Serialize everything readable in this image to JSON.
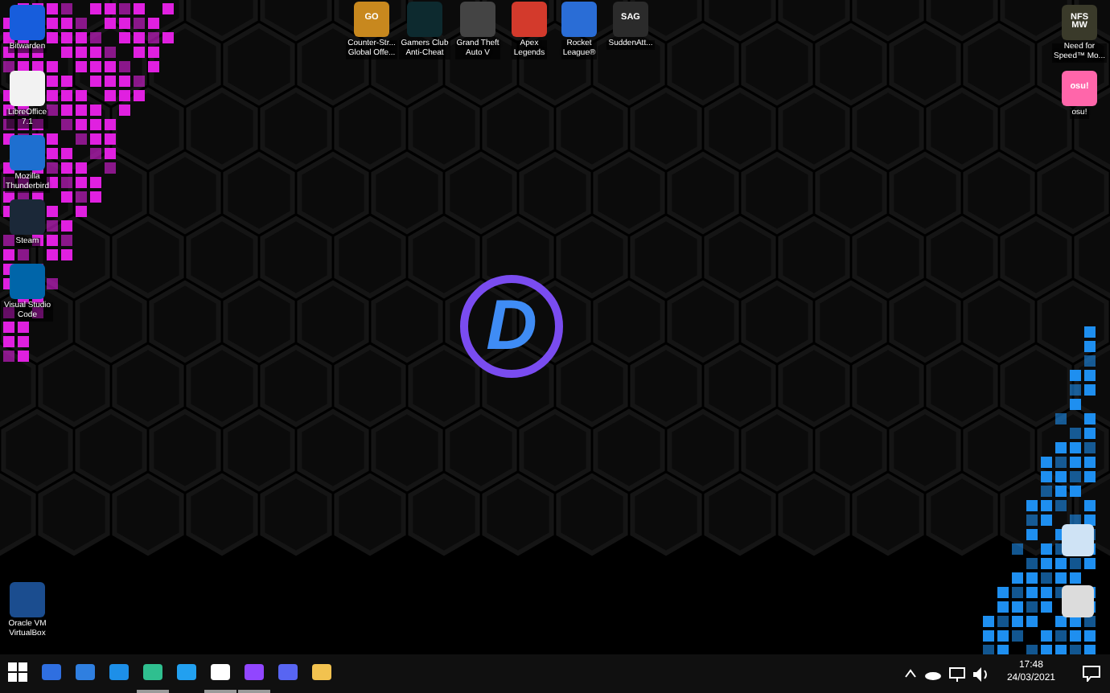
{
  "desktop_icons": [
    {
      "label": "Bitwarden"
    },
    {
      "label": "LibreOffice\n7.1"
    },
    {
      "label": "Mozilla\nThunderbird"
    },
    {
      "label": "Steam"
    },
    {
      "label": "Visual Studio\nCode"
    },
    {
      "label": "Oracle VM\nVirtualBox"
    },
    {
      "label": "Counter-Str...\nGlobal Offe...",
      "icon_text": "GO"
    },
    {
      "label": "Gamers Club\nAnti-Cheat"
    },
    {
      "label": "Grand Theft\nAuto V"
    },
    {
      "label": "Apex\nLegends"
    },
    {
      "label": "Rocket\nLeague®"
    },
    {
      "label": "SuddenAtt...",
      "icon_text": "SAG"
    },
    {
      "label": "Need for\nSpeed™ Mo...",
      "icon_text": "NFS MW"
    },
    {
      "label": "osu!",
      "icon_text": "osu!"
    }
  ],
  "logo": {
    "text": "D"
  },
  "taskbar": {
    "apps": [
      {
        "running": false
      },
      {
        "running": false
      },
      {
        "running": false
      },
      {
        "running": false
      },
      {
        "running": true
      },
      {
        "running": false
      },
      {
        "running": true
      },
      {
        "running": true
      },
      {
        "running": false
      },
      {
        "running": false
      }
    ]
  },
  "tray": {
    "time": "17:48",
    "date": "24/03/2021"
  }
}
